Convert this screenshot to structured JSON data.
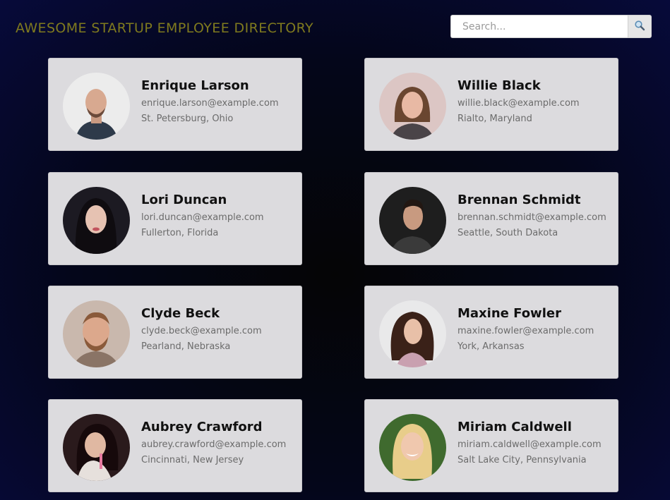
{
  "header": {
    "title": "AWESOME STARTUP EMPLOYEE DIRECTORY",
    "search_placeholder": "Search...",
    "search_value": ""
  },
  "colors": {
    "title": "#7f7a1e",
    "card_bg": "#dcdbde",
    "background": "#04061a"
  },
  "employees": [
    {
      "name": "Enrique Larson",
      "email": "enrique.larson@example.com",
      "location": "St. Petersburg, Ohio"
    },
    {
      "name": "Willie Black",
      "email": "willie.black@example.com",
      "location": "Rialto, Maryland"
    },
    {
      "name": "Lori Duncan",
      "email": "lori.duncan@example.com",
      "location": "Fullerton, Florida"
    },
    {
      "name": "Brennan Schmidt",
      "email": "brennan.schmidt@example.com",
      "location": "Seattle, South Dakota"
    },
    {
      "name": "Clyde Beck",
      "email": "clyde.beck@example.com",
      "location": "Pearland, Nebraska"
    },
    {
      "name": "Maxine Fowler",
      "email": "maxine.fowler@example.com",
      "location": "York, Arkansas"
    },
    {
      "name": "Aubrey Crawford",
      "email": "aubrey.crawford@example.com",
      "location": "Cincinnati, New Jersey"
    },
    {
      "name": "Miriam Caldwell",
      "email": "miriam.caldwell@example.com",
      "location": "Salt Lake City, Pennsylvania"
    }
  ]
}
